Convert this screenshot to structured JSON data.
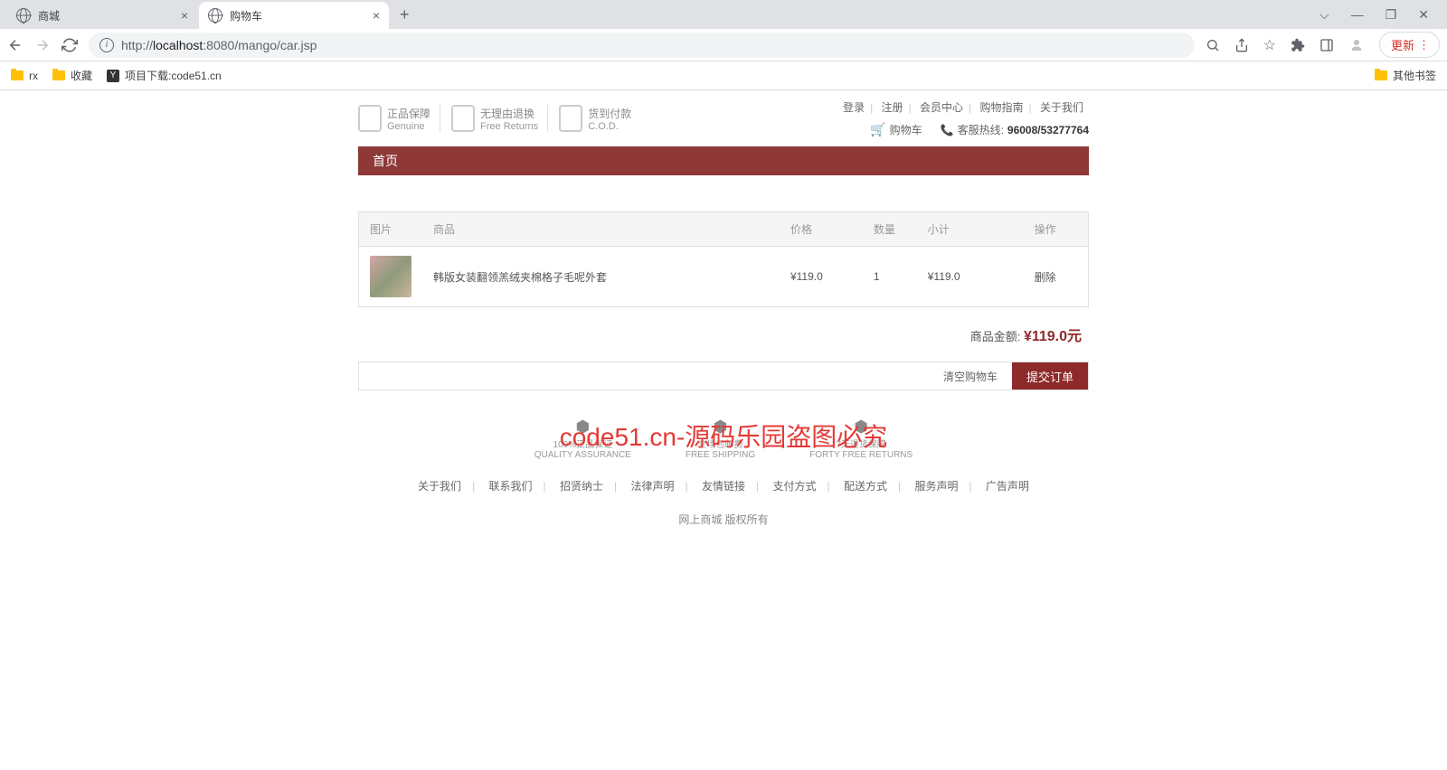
{
  "browser": {
    "tabs": [
      {
        "title": "商城",
        "active": false
      },
      {
        "title": "购物车",
        "active": true
      }
    ],
    "url_prefix": "http://",
    "url_host": "localhost",
    "url_path": ":8080/mango/car.jsp",
    "update_label": "更新",
    "bookmarks": [
      {
        "label": "rx",
        "icon": "folder"
      },
      {
        "label": "收藏",
        "icon": "folder"
      },
      {
        "label": "项目下载:code51.cn",
        "icon": "y"
      }
    ],
    "other_bookmarks": "其他书签"
  },
  "header": {
    "badges": [
      {
        "title": "正品保障",
        "sub": "Genuine"
      },
      {
        "title": "无理由退换",
        "sub": "Free Returns"
      },
      {
        "title": "货到付款",
        "sub": "C.O.D."
      }
    ],
    "top_links": [
      "登录",
      "注册",
      "会员中心",
      "购物指南",
      "关于我们"
    ],
    "cart_label": "购物车",
    "hotline_label": "客服热线:",
    "hotline_num": "96008/53277764"
  },
  "nav": {
    "home": "首页"
  },
  "cart": {
    "columns": {
      "img": "图片",
      "name": "商品",
      "price": "价格",
      "qty": "数量",
      "subtotal": "小计",
      "op": "操作"
    },
    "items": [
      {
        "name": "韩版女装翻领羔绒夹棉格子毛呢外套",
        "price": "¥119.0",
        "qty": "1",
        "subtotal": "¥119.0",
        "op": "删除"
      }
    ],
    "total_label": "商品金额:",
    "total_amount": "¥119.0元",
    "clear_label": "清空购物车",
    "submit_label": "提交订单"
  },
  "footer": {
    "badges": [
      {
        "title": "100%正品保证",
        "sub": "QUALITY ASSURANCE"
      },
      {
        "title": "全场包邮费",
        "sub": "FREE SHIPPING"
      },
      {
        "title": "7天退货保障",
        "sub": "FORTY FREE RETURNS"
      }
    ],
    "links": [
      "关于我们",
      "联系我们",
      "招贤纳士",
      "法律声明",
      "友情链接",
      "支付方式",
      "配送方式",
      "服务声明",
      "广告声明"
    ],
    "copyright": "网上商城 版权所有"
  },
  "watermark": "code51.cn-源码乐园盗图必究"
}
